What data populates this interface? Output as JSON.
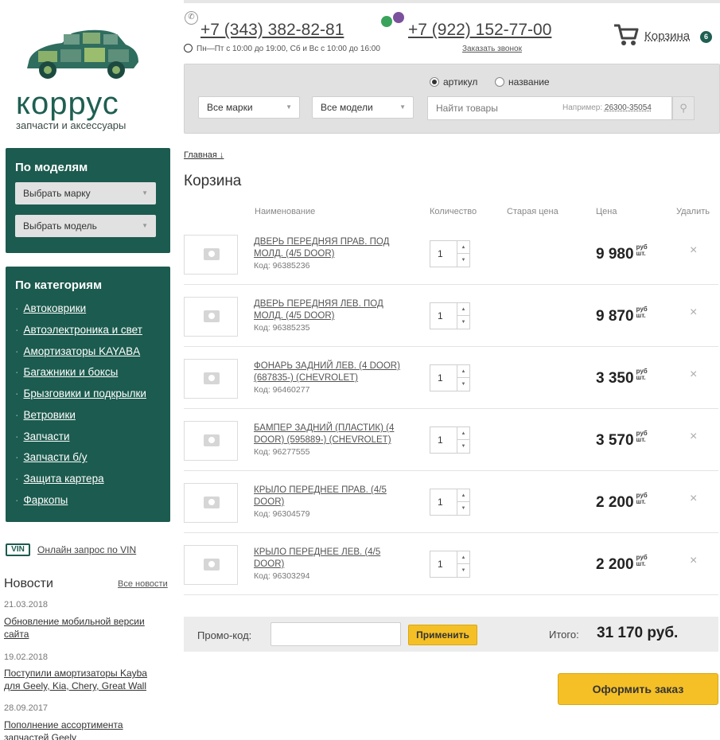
{
  "header": {
    "phone1": "+7 (343) 382-82-81",
    "hours": "Пн—Пт с 10:00 до 19:00, Сб и Вс с 10:00 до 16:00",
    "phone2": "+7 (922) 152-77-00",
    "callback": "Заказать звонок",
    "cart_label": "Корзина",
    "cart_count": "6"
  },
  "logo": {
    "word": "коррус",
    "tagline": "запчасти и аксессуары"
  },
  "search": {
    "brand_select": "Все марки",
    "model_select": "Все модели",
    "radio_article": "артикул",
    "radio_name": "название",
    "placeholder": "Найти товары",
    "example_label": "Например:",
    "example_value": "26300-35054"
  },
  "sidebar": {
    "models_title": "По моделям",
    "select_brand": "Выбрать марку",
    "select_model": "Выбрать модель",
    "categories_title": "По категориям",
    "categories": [
      "Автоковрики",
      "Автоэлектроника и свет",
      "Амортизаторы KAYABA",
      "Багажники и боксы",
      "Брызговики и подкрылки",
      "Ветровики",
      "Запчасти",
      "Запчасти б/у",
      "Защита картера",
      "Фаркопы"
    ],
    "vin_badge": "VIN",
    "vin_link": "Онлайн запрос по VIN",
    "news_title": "Новости",
    "news_all": "Все новости",
    "news": [
      {
        "date": "21.03.2018",
        "text": "Обновление мобильной версии сайта"
      },
      {
        "date": "19.02.2018",
        "text": "Поступили амортизаторы Kayba для Geely, Kia, Chery, Great Wall"
      },
      {
        "date": "28.09.2017",
        "text": "Пополнение ассортимента запчастей Geely"
      }
    ]
  },
  "main": {
    "breadcrumb": "Главная ↓",
    "title": "Корзина",
    "columns": {
      "name": "Наименование",
      "qty": "Количество",
      "old_price": "Старая цена",
      "price": "Цена",
      "delete": "Удалить"
    },
    "unit_rub": "руб",
    "unit_pcs": "шт.",
    "items": [
      {
        "name": "ДВЕРЬ ПЕРЕДНЯЯ ПРАВ. ПОД МОЛД. (4/5 DOOR)",
        "code": "Код: 96385236",
        "qty": "1",
        "price": "9 980"
      },
      {
        "name": "ДВЕРЬ ПЕРЕДНЯЯ ЛЕВ. ПОД МОЛД. (4/5 DOOR)",
        "code": "Код: 96385235",
        "qty": "1",
        "price": "9 870"
      },
      {
        "name": "ФОНАРЬ ЗАДНИЙ ЛЕВ. (4 DOOR) (687835-) (CHEVROLET)",
        "code": "Код: 96460277",
        "qty": "1",
        "price": "3 350"
      },
      {
        "name": "БАМПЕР ЗАДНИЙ (ПЛАСТИК) (4 DOOR) (595889-) (CHEVROLET)",
        "code": "Код: 96277555",
        "qty": "1",
        "price": "3 570"
      },
      {
        "name": "КРЫЛО ПЕРЕДНЕЕ ПРАВ. (4/5 DOOR)",
        "code": "Код: 96304579",
        "qty": "1",
        "price": "2 200"
      },
      {
        "name": "КРЫЛО ПЕРЕДНЕЕ ЛЕВ. (4/5 DOOR)",
        "code": "Код: 96303294",
        "qty": "1",
        "price": "2 200"
      }
    ],
    "promo_label": "Промо-код:",
    "apply_button": "Применить",
    "total_label": "Итого:",
    "total_value": "31 170 руб.",
    "order_button": "Оформить заказ"
  },
  "colors": {
    "brand_green": "#1c5b4f",
    "accent_yellow": "#f5c026"
  }
}
